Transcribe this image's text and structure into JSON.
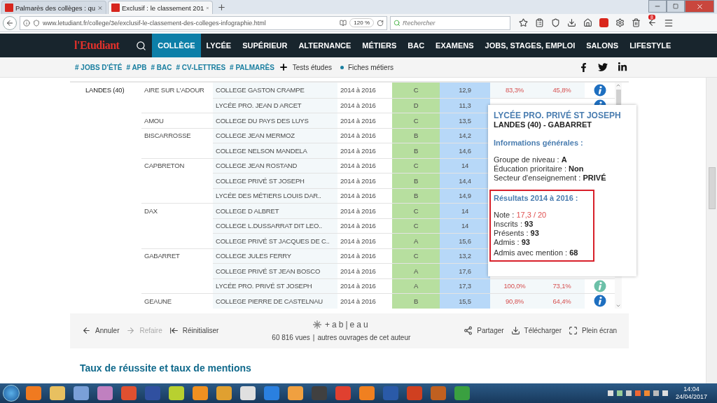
{
  "browser": {
    "tabs": [
      {
        "title": "Palmarès des collèges : qu",
        "selected": false
      },
      {
        "title": "Exclusif : le classement 201",
        "selected": true
      }
    ],
    "url": "www.letudiant.fr/college/3e/exclusif-le-classement-des-colleges-infographie.html",
    "zoom": "120 %",
    "search": {
      "placeholder": "Rechercher"
    },
    "badge": "8"
  },
  "site_nav": {
    "logo": "l'Etudiant",
    "items": [
      {
        "label": "COLLÈGE",
        "selected": true
      },
      {
        "label": "LYCÉE",
        "selected": false
      },
      {
        "label": "SUPÉRIEUR",
        "selected": false
      },
      {
        "label": "ALTERNANCE",
        "selected": false
      },
      {
        "label": "MÉTIERS",
        "selected": false
      },
      {
        "label": "BAC",
        "selected": false
      },
      {
        "label": "EXAMENS",
        "selected": false
      },
      {
        "label": "JOBS, STAGES, EMPLOI",
        "selected": false
      },
      {
        "label": "SALONS",
        "selected": false
      },
      {
        "label": "LIFESTYLE",
        "selected": false
      }
    ]
  },
  "sub_nav": {
    "tags": [
      "# JOBS D'ÉTÉ",
      "# APB",
      "# BAC",
      "# CV-LETTRES",
      "# PALMARÈS"
    ],
    "links": [
      {
        "label": "Tests études",
        "kind": "plus"
      },
      {
        "label": "Fiches métiers",
        "kind": "dot"
      }
    ]
  },
  "table": {
    "rows": [
      {
        "department": "LANDES (40)",
        "city": "AIRE SUR L'ADOUR",
        "school": "COLLEGE GASTON CRAMPE",
        "years": "2014 à 2016",
        "group": "C",
        "note": "12,9",
        "rate": "83,3%",
        "mention": "45,8%",
        "info_active": false
      },
      {
        "school": "LYCÉE PRO. JEAN D ARCET",
        "years": "2014 à 2016",
        "group": "D",
        "note": "11,3",
        "info_active": false
      },
      {
        "city": "AMOU",
        "school": "COLLEGE DU PAYS DES LUYS",
        "years": "2014 à 2016",
        "group": "C",
        "note": "13,5"
      },
      {
        "city": "BISCARROSSE",
        "school": "COLLEGE JEAN MERMOZ",
        "years": "2014 à 2016",
        "group": "B",
        "note": "14,2"
      },
      {
        "school": "COLLEGE NELSON MANDELA",
        "years": "2014 à 2016",
        "group": "B",
        "note": "14,6"
      },
      {
        "city": "CAPBRETON",
        "school": "COLLEGE JEAN ROSTAND",
        "years": "2014 à 2016",
        "group": "C",
        "note": "14"
      },
      {
        "school": "COLLEGE PRIVÉ ST JOSEPH",
        "years": "2014 à 2016",
        "group": "B",
        "note": "14,4"
      },
      {
        "school": "LYCÉE DES MÉTIERS LOUIS DAR..",
        "years": "2014 à 2016",
        "group": "B",
        "note": "14,9"
      },
      {
        "city": "DAX",
        "school": "COLLEGE D ALBRET",
        "years": "2014 à 2016",
        "group": "C",
        "note": "14"
      },
      {
        "school": "COLLEGE L.DUSSARRAT DIT LEO..",
        "years": "2014 à 2016",
        "group": "C",
        "note": "14"
      },
      {
        "school": "COLLEGE PRIVÉ ST JACQUES DE C..",
        "years": "2014 à 2016",
        "group": "A",
        "note": "15,6"
      },
      {
        "city": "GABARRET",
        "school": "COLLEGE JULES FERRY",
        "years": "2014 à 2016",
        "group": "C",
        "note": "13,2"
      },
      {
        "school": "COLLEGE PRIVÉ ST JEAN BOSCO",
        "years": "2014 à 2016",
        "group": "A",
        "note": "17,6"
      },
      {
        "school": "LYCÉE PRO. PRIVÉ ST JOSEPH",
        "years": "2014 à 2016",
        "group": "A",
        "note": "17,3",
        "rate": "100,0%",
        "mention": "73,1%",
        "info_active": true
      },
      {
        "city": "GEAUNE",
        "school": "COLLEGE PIERRE DE CASTELNAU",
        "years": "2014 à 2016",
        "group": "B",
        "note": "15,5",
        "rate": "90,8%",
        "mention": "64,4%",
        "info_active": false
      }
    ]
  },
  "tooltip": {
    "title": "LYCÉE PRO. PRIVÉ ST JOSEPH",
    "subtitle": "LANDES (40) - GABARRET",
    "general_heading": "Informations générales :",
    "general": [
      {
        "label": "Groupe de niveau :",
        "value": "A",
        "highlight": false
      },
      {
        "label": "Éducation prioritaire :",
        "value": "Non",
        "highlight": false
      },
      {
        "label": "Secteur d'enseignement :",
        "value": "PRIVÉ",
        "highlight": false
      }
    ],
    "results_heading": "Résultats 2014 à 2016 :",
    "results": [
      {
        "label": "Note :",
        "value": "17,3 / 20",
        "highlight": true
      },
      {
        "label": "Inscrits :",
        "value": "93",
        "highlight": false
      },
      {
        "label": "Présents :",
        "value": "93",
        "highlight": false
      },
      {
        "label": "Admis :",
        "value": "93",
        "highlight": false
      },
      {
        "label": "Admis avec mention :",
        "value": "68",
        "highlight": false
      }
    ]
  },
  "toolbar": {
    "left": [
      {
        "label": "Annuler",
        "kind": "undo",
        "disabled": false
      },
      {
        "label": "Refaire",
        "kind": "redo",
        "disabled": true
      },
      {
        "label": "Réinitialiser",
        "kind": "reset",
        "disabled": false
      }
    ],
    "logo": "+ab|eau",
    "views": "60 816 vues",
    "separator": "|",
    "author_link": "autres ouvrages de cet auteur",
    "right": [
      {
        "label": "Partager",
        "kind": "share"
      },
      {
        "label": "Télécharger",
        "kind": "download"
      },
      {
        "label": "Plein écran",
        "kind": "fullscreen"
      }
    ]
  },
  "section_heading": "Taux de réussite et taux de mentions",
  "taskbar": {
    "time": "14:04",
    "date": "24/04/2017"
  }
}
